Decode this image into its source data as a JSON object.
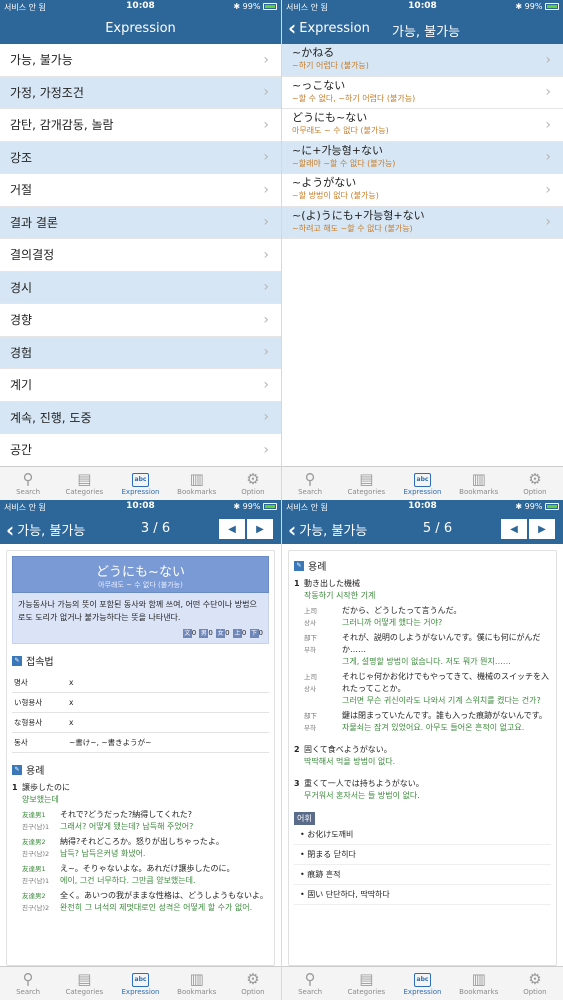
{
  "status": {
    "carrier": "서비스 안 됨",
    "time": "10:08",
    "battery": "99%"
  },
  "tabs": [
    {
      "label": "Search",
      "icon": "search-icon"
    },
    {
      "label": "Categories",
      "icon": "categories-icon"
    },
    {
      "label": "Expression",
      "icon": "abc-icon"
    },
    {
      "label": "Bookmarks",
      "icon": "book-icon"
    },
    {
      "label": "Option",
      "icon": "gear-icon"
    }
  ],
  "abc": "abc",
  "pane1": {
    "title": "Expression",
    "items": [
      "가능, 불가능",
      "가정, 가정조건",
      "감탄, 감개감동, 놀람",
      "강조",
      "거절",
      "결과 결론",
      "결의결정",
      "경시",
      "경향",
      "경험",
      "계기",
      "계속, 진행, 도중",
      "공간"
    ]
  },
  "pane2": {
    "back": "Expression",
    "title": "가능, 불가능",
    "items": [
      {
        "jp": "~かねる",
        "ko": "~하기 어렵다 (불가능)"
      },
      {
        "jp": "~っこない",
        "ko": "~할 수 없다, ~하기 어렵다 (불가능)"
      },
      {
        "jp": "どうにも~ない",
        "ko": "아무래도 ~ 수 없다 (불가능)"
      },
      {
        "jp": "~に+가능형+ない",
        "ko": "~할래야 ~할 수 없다 (불가능)"
      },
      {
        "jp": "~ようがない",
        "ko": "~할 방법이 없다 (불가능)"
      },
      {
        "jp": "~(よ)うにも+가능형+ない",
        "ko": "~하려고 해도 ~할 수 없다 (불가능)"
      }
    ]
  },
  "pane3": {
    "back": "가능, 불가능",
    "pager": "3 / 6",
    "prev": "◀",
    "next": "▶",
    "heading": "どうにも~ない",
    "heading_sub": "아무래도 ~ 수 없다 (불가능)",
    "description": "가능동사나 가능의 뜻이 포함된 동사와 함께 쓰여, 어떤 수단이나 방법으로도 도리가 없거나 불가능하다는 뜻을 나타낸다.",
    "flags": [
      "文",
      "0",
      "男",
      "0",
      "女",
      "0",
      "上",
      "0",
      "下",
      "0"
    ],
    "conj_title": "접속법",
    "conj": [
      {
        "k": "명사",
        "v": "x"
      },
      {
        "k": "い형용사",
        "v": "x"
      },
      {
        "k": "な형용사",
        "v": "x"
      },
      {
        "k": "동사",
        "v": "~書け~, ~書きようが~"
      }
    ],
    "usage_title": "용례",
    "ex_num": "1",
    "ex_jp": "譲歩したのに",
    "ex_ko": "양보했는데",
    "dialog": [
      {
        "w": "友達男1",
        "wk": "친구(남)1",
        "t": "それで?どうだった?納得してくれた?",
        "k": "그래서? 어떻게 됐는데? 납득해 주었어?"
      },
      {
        "w": "友達男2",
        "wk": "친구(남)2",
        "t": "納得?それどころか。怒りが出しちゃったよ。",
        "k": "납득? 납득은커녕 화냈어."
      },
      {
        "w": "友達男1",
        "wk": "친구(남)1",
        "t": "え~。そりゃないよな。あれだけ譲歩したのに。",
        "k": "에이, 그건 너무하다. 그만큼 양보했는데."
      },
      {
        "w": "友達男2",
        "wk": "친구(남)2",
        "t": "全く。あいつの我がままな性格は、どうしようもないよ。",
        "k": "완전히 그 녀석의 제멋대로인 성격은 어떻게 할 수가 없어."
      }
    ]
  },
  "pane4": {
    "back": "가능, 불가능",
    "pager": "5 / 6",
    "prev": "◀",
    "next": "▶",
    "usage_title": "용례",
    "ex1_num": "1",
    "ex1_jp": "動き出した機械",
    "ex1_ko": "작동하기 시작한 기계",
    "dialog": [
      {
        "w": "上司",
        "wk": "상사",
        "t": "だから、どうしたって言うんだ。",
        "k": "그러니까 어떻게 했다는 거야?"
      },
      {
        "w": "部下",
        "wk": "부하",
        "t": "それが、説明のしようがないんです。僕にも何にがんだか……",
        "k": "그게, 설명할 방법이 없습니다. 저도 뭐가 뭔지……"
      },
      {
        "w": "上司",
        "wk": "상사",
        "t": "それじゃ何かお化けでもやってきて、機械のスイッチを入れたってことか。",
        "k": "그러면 무슨 귀신이라도 나와서 기계 스위치를 켰다는 건가?"
      },
      {
        "w": "部下",
        "wk": "부하",
        "t": "鍵は閉まっていたんです。誰も入った痕跡がないんです。",
        "k": "자물쇠는 잠겨 있었어요. 아무도 들어온 흔적이 없고요."
      }
    ],
    "ex2_num": "2",
    "ex2_jp": "固くて食べようがない。",
    "ex2_ko": "딱딱해서 먹을 방법이 없다.",
    "ex3_num": "3",
    "ex3_jp": "重くて一人では持ちようがない。",
    "ex3_ko": "무거워서 혼자서는 들 방법이 없다.",
    "vocab_title": "어휘",
    "vocab": [
      "お化け도깨비",
      "閉まる 닫히다",
      "痕跡 흔적",
      "固い 단단하다, 딱딱하다"
    ]
  }
}
